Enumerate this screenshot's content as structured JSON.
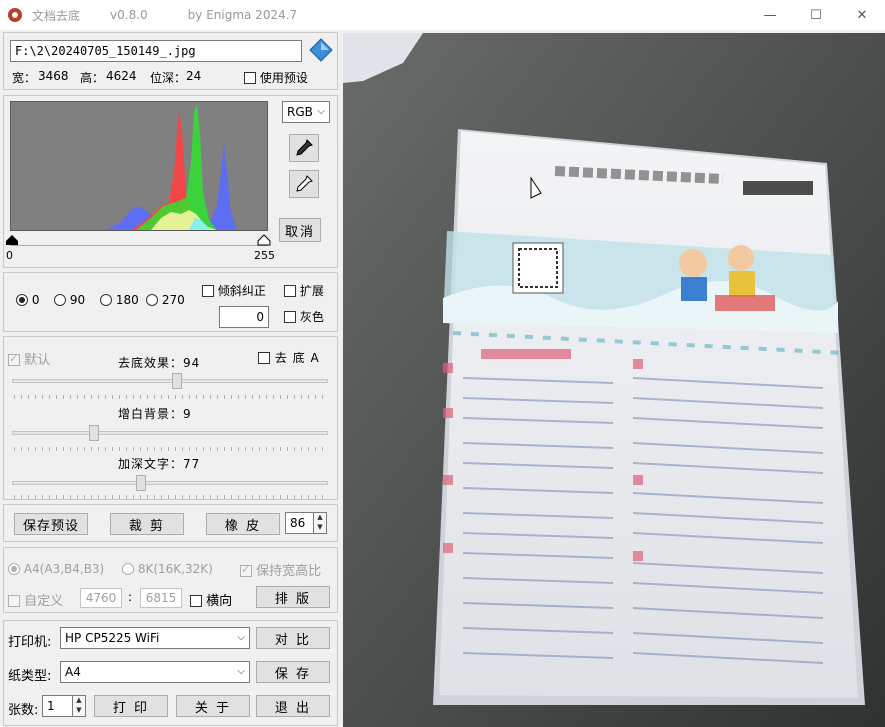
{
  "window": {
    "app_name": "文档去底",
    "version": "v0.8.0",
    "author": "by Enigma 2024.7",
    "minimize": "—",
    "maximize": "☐",
    "close": "✕"
  },
  "file": {
    "path": "F:\\2\\20240705_150149_.jpg",
    "width_label": "宽：",
    "width": "3468",
    "height_label": "高：",
    "height": "4624",
    "depth_label": "位深：",
    "depth": "24",
    "use_preset_label": "使用预设"
  },
  "histogram": {
    "channel": "RGB",
    "min_label": "0",
    "max_label": "255",
    "cancel_label": "取消"
  },
  "rotation": {
    "options": [
      "0",
      "90",
      "180",
      "270"
    ],
    "selected": "0",
    "deskew_label": "倾斜纠正",
    "expand_label": "扩展",
    "gray_label": "灰色",
    "angle_value": "0"
  },
  "adjust": {
    "default_label": "默认",
    "remove_bg_label": "去底效果：94",
    "remove_bg_value": 94,
    "qudi_a_label": "去 底 A",
    "whiten_label": "增白背景：9",
    "whiten_value": 9,
    "darken_label": "加深文字：77",
    "darken_value": 77
  },
  "actions": {
    "save_preset": "保存预设",
    "crop": "裁 剪",
    "eraser": "橡 皮",
    "eraser_size": "86"
  },
  "paper": {
    "a4_label": "A4(A3,B4,B3)",
    "k8_label": "8K(16K,32K)",
    "keep_ratio_label": "保持宽高比",
    "custom_label": "自定义",
    "custom_w": "4760",
    "sep": ":",
    "custom_h": "6815",
    "landscape_label": "横向",
    "layout_btn": "排 版"
  },
  "print": {
    "printer_label": "打印机:",
    "printer_value": "HP CP5225 WiFi",
    "compare_btn": "对 比",
    "paper_type_label": "纸类型:",
    "paper_type_value": "A4",
    "save_btn": "保 存",
    "copies_label": "张数:",
    "copies_value": "1",
    "print_btn": "打 印",
    "about_btn": "关 于",
    "exit_btn": "退 出"
  },
  "colors": {
    "accent": "#0078d7",
    "hist_bg": "#808080"
  }
}
